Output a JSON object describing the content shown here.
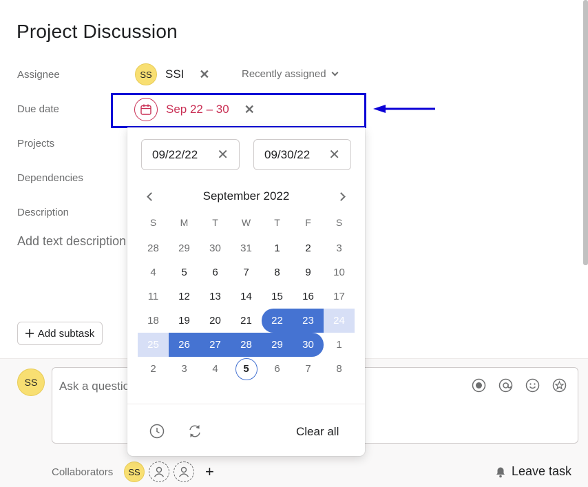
{
  "task": {
    "title": "Project Discussion"
  },
  "fields": {
    "assignee_label": "Assignee",
    "due_label": "Due date",
    "projects_label": "Projects",
    "dependencies_label": "Dependencies",
    "description_label": "Description"
  },
  "assignee": {
    "initials": "SS",
    "name": "SSI",
    "remove": "✕",
    "recent_label": "Recently assigned"
  },
  "due": {
    "text": "Sep 22 – 30",
    "remove": "✕"
  },
  "description": {
    "placeholder": "Add text description"
  },
  "subtask": {
    "label": "Add subtask"
  },
  "comment": {
    "avatar": "SS",
    "placeholder": "Ask a question or post an update…"
  },
  "collaborators": {
    "label": "Collaborators",
    "avatar": "SS",
    "add": "+"
  },
  "leave_task": {
    "label": "Leave task"
  },
  "datepicker": {
    "start": "09/22/22",
    "end": "09/30/22",
    "clear": "✕",
    "month": "September 2022",
    "weekdays": [
      "S",
      "M",
      "T",
      "W",
      "T",
      "F",
      "S"
    ],
    "weeks": [
      [
        "28",
        "29",
        "30",
        "31",
        "1",
        "2",
        "3"
      ],
      [
        "4",
        "5",
        "6",
        "7",
        "8",
        "9",
        "10"
      ],
      [
        "11",
        "12",
        "13",
        "14",
        "15",
        "16",
        "17"
      ],
      [
        "18",
        "19",
        "20",
        "21",
        "22",
        "23",
        "24"
      ],
      [
        "25",
        "26",
        "27",
        "28",
        "29",
        "30",
        "1"
      ],
      [
        "2",
        "3",
        "4",
        "5",
        "6",
        "7",
        "8"
      ]
    ],
    "today": "5",
    "clear_all": "Clear all"
  },
  "colors": {
    "accent": "#4573d2",
    "due": "#c92f54",
    "highlight": "#0b00d6",
    "avatar": "#f8df72"
  }
}
